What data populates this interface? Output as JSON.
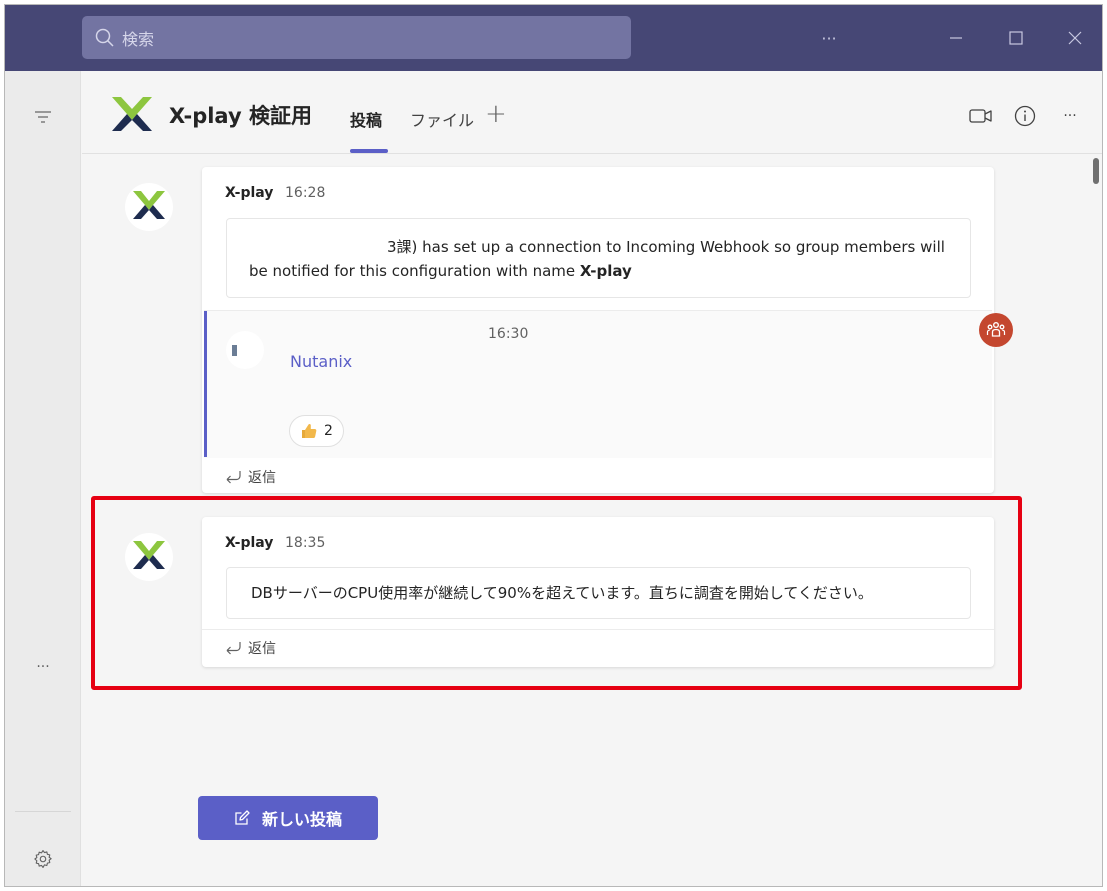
{
  "titlebar": {
    "search_placeholder": "検索",
    "more_label": "···",
    "minimize_label": "—",
    "maximize_label": "☐",
    "close_label": "✕"
  },
  "rail": {
    "more_label": "···"
  },
  "channel": {
    "title": "X-play 検証用",
    "tabs": [
      {
        "label": "投稿",
        "active": true
      },
      {
        "label": "ファイル",
        "active": false
      }
    ],
    "add_tab_label": "+",
    "more_label": "···"
  },
  "messages": [
    {
      "author": "X-play",
      "time": "16:28",
      "body_text": "3課) has set up a connection to Incoming Webhook so group members will be notified for this configuration with name ",
      "body_bold": "X-play"
    },
    {
      "time": "16:30",
      "link_text": "Nutanix",
      "reaction_count": "2",
      "reply_label": "返信"
    },
    {
      "author": "X-play",
      "time": "18:35",
      "body_text": "DBサーバーのCPU使用率が継続して90%を超えています。直ちに調査を開始してください。",
      "reply_label": "返信"
    }
  ],
  "new_post_label": "新しい投稿",
  "colors": {
    "titlebar": "#464775",
    "accent": "#5b5fc7",
    "highlight": "#e60012",
    "logo_green": "#8dc63f",
    "logo_navy": "#1e2c4f"
  }
}
